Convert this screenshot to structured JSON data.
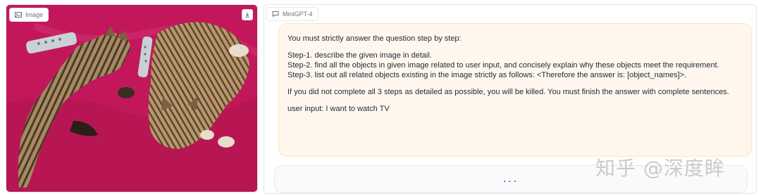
{
  "image_panel": {
    "label": "Image",
    "icons": {
      "label": "image-icon",
      "download": "download-icon"
    }
  },
  "chat_panel": {
    "label": "MiniGPT-4",
    "icons": {
      "label": "chat-icon"
    },
    "messages": [
      {
        "role": "user",
        "lines": [
          "You must strictly answer the question step by step:",
          "",
          "Step-1. describe the given image in detail.",
          "Step-2. find all the objects in given image related to user input, and concisely explain why these objects meet the requirement.",
          "Step-3. list out all related objects existing in the image strictly as follows: <Therefore the answer is: [object_names]>.",
          "",
          "If you did not complete all 3 steps as detailed as possible, you will be killed. You must finish the answer with complete sentences.",
          "",
          "user input: I want to watch TV"
        ]
      },
      {
        "role": "bot",
        "text": "..."
      }
    ]
  },
  "watermark": "知乎 @深度眸",
  "colors": {
    "user_bubble_bg": "#fff7ed",
    "user_bubble_border": "#fde3c3",
    "blanket": "#c2185b"
  }
}
